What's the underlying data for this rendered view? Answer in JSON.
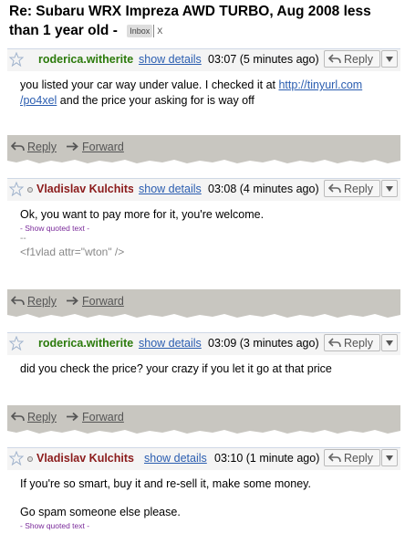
{
  "subject": {
    "title": "Re: Subaru WRX Impreza AWD TURBO, Aug 2008 less than 1 year old -",
    "label": "Inbox",
    "label_remove": "X"
  },
  "common": {
    "show_details": "show details",
    "reply": "Reply",
    "forward": "Forward",
    "show_quoted": "- Show quoted text -"
  },
  "messages": [
    {
      "sender": "roderica.witherite",
      "time": "03:07 (5 minutes ago)",
      "body_line1": "you listed your car way under value. I checked it at ",
      "link": "http://tinyurl.com/po4xel",
      "link_part1": "http://tinyurl.com",
      "link_part2": "/po4xel",
      "body_line2": " and the price your asking for is way off"
    },
    {
      "sender": "Vladislav Kulchits",
      "time": "03:08 (4 minutes ago)",
      "body": "Ok, you want to pay more for it, you're welcome.",
      "sig_sep": "--",
      "sig": "<f1vlad attr=\"wton\" />"
    },
    {
      "sender": "roderica.witherite",
      "time": "03:09 (3 minutes ago)",
      "body": "did you check the price? your crazy if you let it go at that price"
    },
    {
      "sender": "Vladislav Kulchits",
      "time": "03:10 (1 minute ago)",
      "body_p1": "If you're so smart, buy it and re-sell it, make some money.",
      "body_p2": "Go spam someone else please."
    }
  ]
}
